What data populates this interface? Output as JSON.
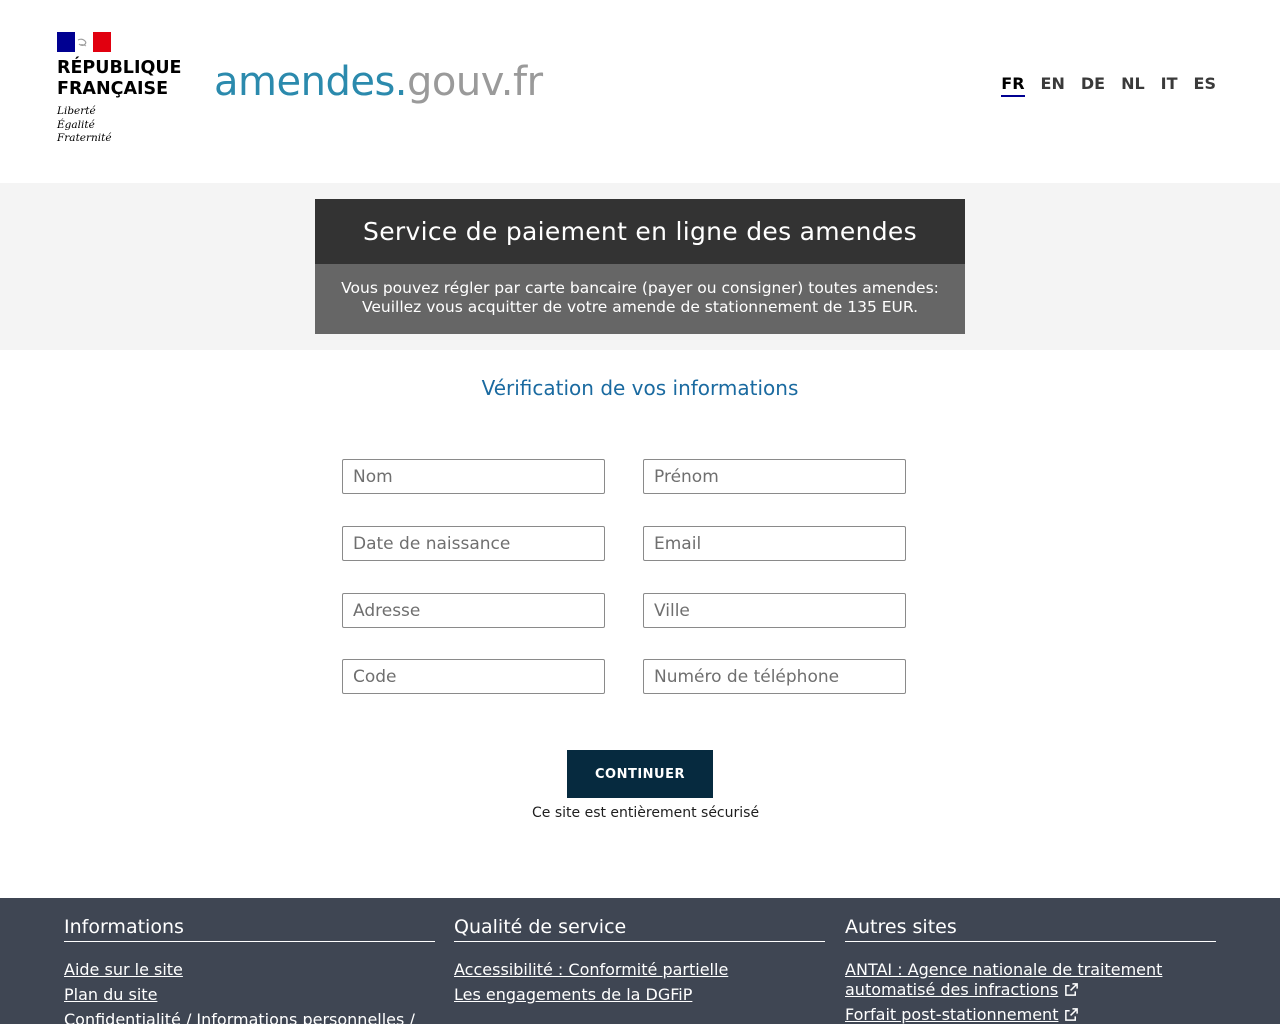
{
  "header": {
    "republique_line1": "RÉPUBLIQUE",
    "republique_line2": "FRANÇAISE",
    "devise_1": "Liberté",
    "devise_2": "Égalité",
    "devise_3": "Fraternité",
    "site_name_part1": "amendes.",
    "site_name_part2": "gouv.fr",
    "languages": [
      "FR",
      "EN",
      "DE",
      "NL",
      "IT",
      "ES"
    ],
    "active_language": "FR"
  },
  "banner": {
    "title": "Service de paiement en ligne des amendes",
    "line1": "Vous pouvez régler par carte bancaire (payer ou consigner) toutes amendes:",
    "line2": "Veuillez vous acquitter de votre amende de stationnement de 135 EUR."
  },
  "form": {
    "title": "Vérification de vos informations",
    "fields": {
      "nom": "Nom",
      "prenom": "Prénom",
      "date_naissance": "Date de naissance",
      "email": "Email",
      "adresse": "Adresse",
      "ville": "Ville",
      "code": "Code",
      "telephone": "Numéro de téléphone"
    },
    "submit_label": "CONTINUER",
    "secure_note": "Ce site est entièrement sécurisé"
  },
  "footer": {
    "col1": {
      "title": "Informations",
      "links": [
        "Aide sur le site",
        "Plan du site",
        "Confidentialité / Informations personnelles /"
      ]
    },
    "col2": {
      "title": "Qualité de service",
      "links": [
        "Accessibilité : Conformité partielle",
        "Les engagements de la DGFiP"
      ]
    },
    "col3": {
      "title": "Autres sites",
      "links": [
        "ANTAI : Agence nationale de traitement automatisé des infractions",
        "Forfait post-stationnement"
      ]
    }
  },
  "colors": {
    "marianne_blue": "#000091",
    "marianne_red": "#e1000f",
    "logo_blue": "#2b8aad",
    "logo_grey": "#9a9a9a",
    "section_title": "#1a6aa0",
    "button": "#062a3f",
    "footer_bg": "#3f4653"
  }
}
